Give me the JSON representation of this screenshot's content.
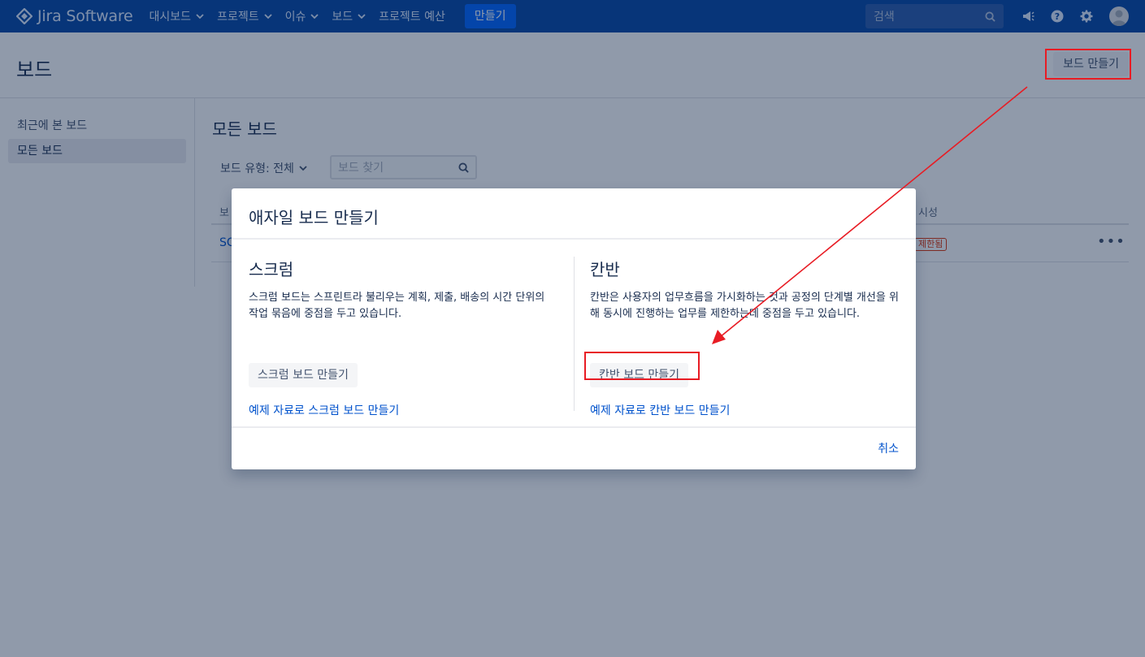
{
  "nav": {
    "logo": "Jira Software",
    "items": [
      {
        "label": "대시보드",
        "dropdown": true
      },
      {
        "label": "프로젝트",
        "dropdown": true
      },
      {
        "label": "이슈",
        "dropdown": true
      },
      {
        "label": "보드",
        "dropdown": true
      },
      {
        "label": "프로젝트 예산",
        "dropdown": false
      }
    ],
    "create": "만들기",
    "search_placeholder": "검색",
    "icons": [
      "megaphone-icon",
      "help-icon",
      "settings-icon",
      "avatar"
    ]
  },
  "page": {
    "title": "보드",
    "create_board": "보드 만들기"
  },
  "sidebar": {
    "items": [
      {
        "label": "최근에 본 보드",
        "active": false
      },
      {
        "label": "모든 보드",
        "active": true
      }
    ]
  },
  "main": {
    "title": "모든 보드",
    "filter_label": "보드 유형: 전체",
    "search_placeholder": "보드 찾기",
    "col_name_partial": "보",
    "col_visibility_partial": "시성",
    "row_name_partial": "SC",
    "row_visibility": "제한됨",
    "row_more": "•••"
  },
  "modal": {
    "title": "애자일 보드 만들기",
    "scrum": {
      "title": "스크럼",
      "description": "스크럼 보드는 스프린트라 불리우는 계획, 제출, 배송의 시간 단위의 작업 묶음에 중점을 두고 있습니다.",
      "button": "스크럼 보드 만들기",
      "link": "예제 자료로 스크럼 보드 만들기"
    },
    "kanban": {
      "title": "칸반",
      "description": "칸반은 사용자의 업무흐름을 가시화하는 것과 공정의 단계별 개선을 위해 동시에 진행하는 업무를 제한하는데 중점을 두고 있습니다.",
      "button": "칸반 보드 만들기",
      "link": "예제 자료로 칸반 보드 만들기"
    },
    "cancel": "취소"
  },
  "colors": {
    "nav_bg": "#0747a6",
    "primary_button": "#0065ff",
    "link": "#0052cc",
    "annotation": "#e81c24",
    "overlay": "rgba(9,30,66,0.45)"
  }
}
